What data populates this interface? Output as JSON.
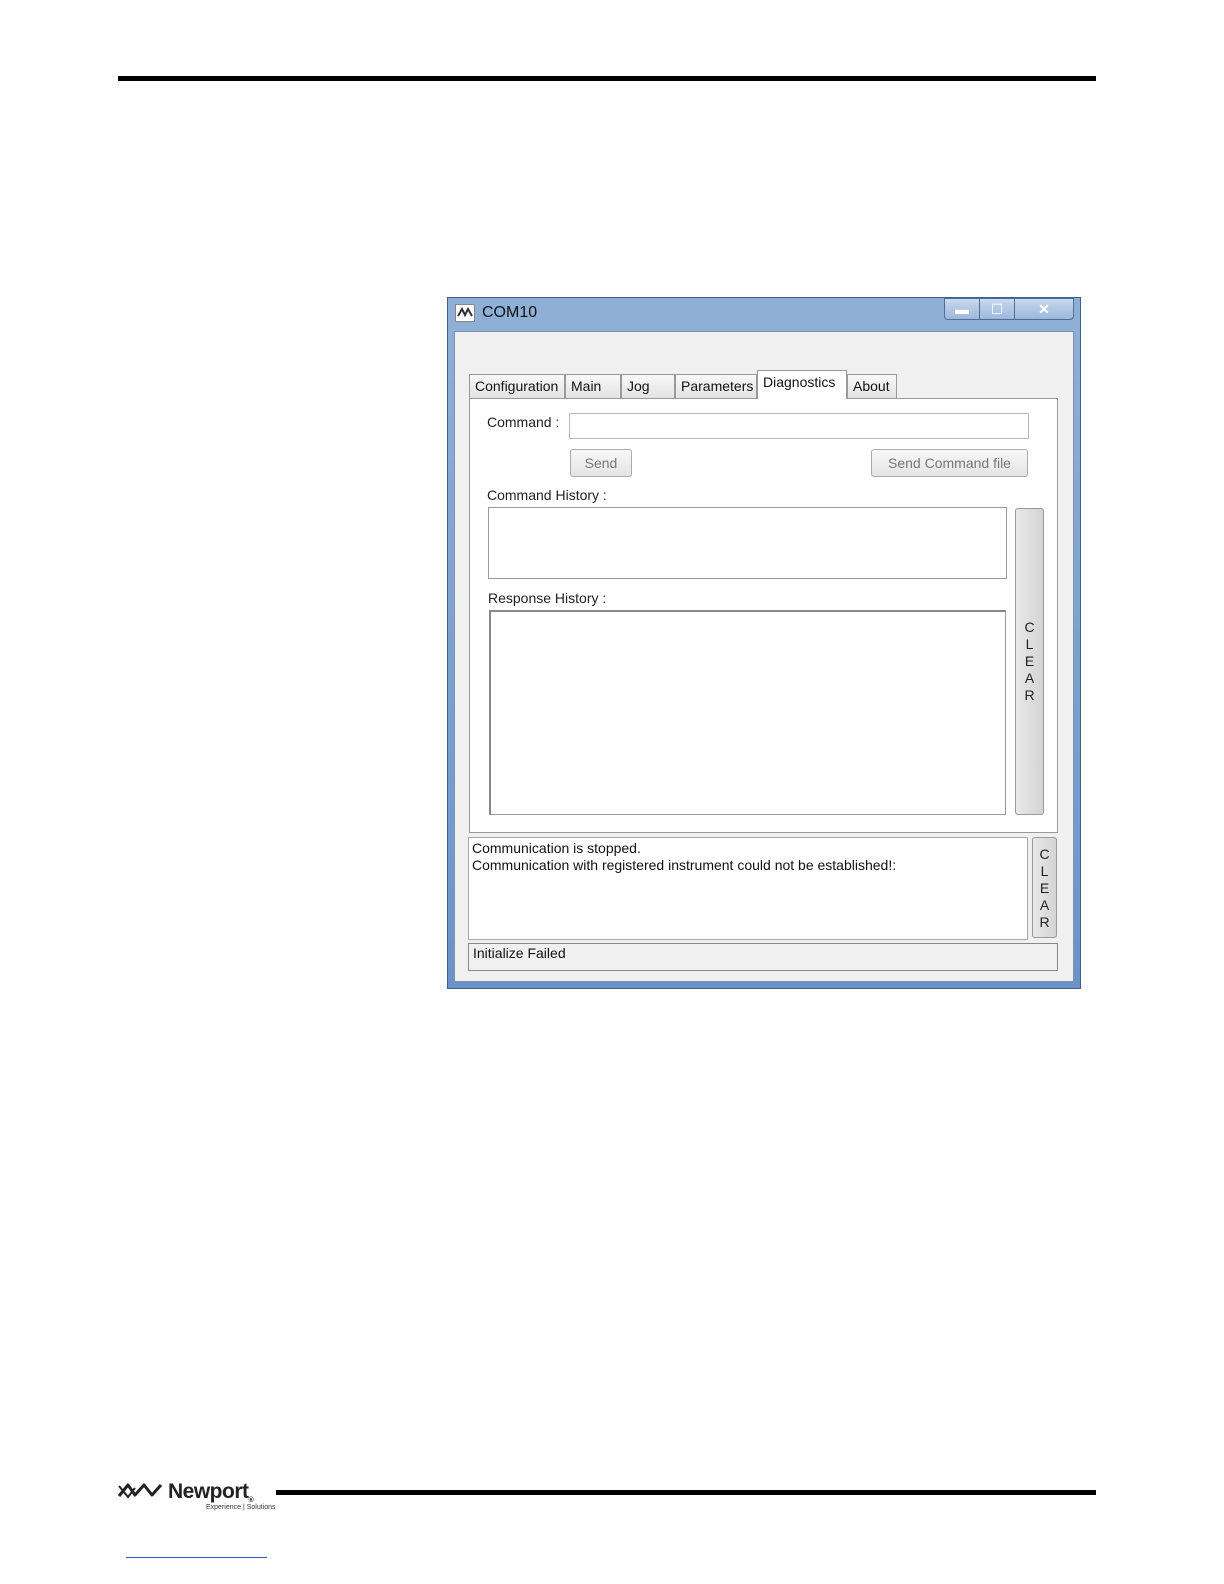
{
  "window": {
    "title": "COM10",
    "min_glyph": "▬",
    "max_glyph": "☐",
    "close_glyph": "✕"
  },
  "tabs": [
    {
      "label": "Configuration"
    },
    {
      "label": "Main"
    },
    {
      "label": "Jog"
    },
    {
      "label": "Parameters"
    },
    {
      "label": "Diagnostics",
      "active": true
    },
    {
      "label": "About"
    }
  ],
  "diagnostics": {
    "command_label": "Command :",
    "command_value": "",
    "send_label": "Send",
    "send_file_label": "Send Command file",
    "command_history_label": "Command History :",
    "response_history_label": "Response History :",
    "clear_label": "CLEAR"
  },
  "log": {
    "lines": [
      "Communication is stopped.",
      "Communication with registered instrument could not be established!:"
    ],
    "clear_label": "CLEAR"
  },
  "status": "Initialize Failed",
  "footer": {
    "brand": "Newport",
    "tagline": "Experience | Solutions"
  }
}
